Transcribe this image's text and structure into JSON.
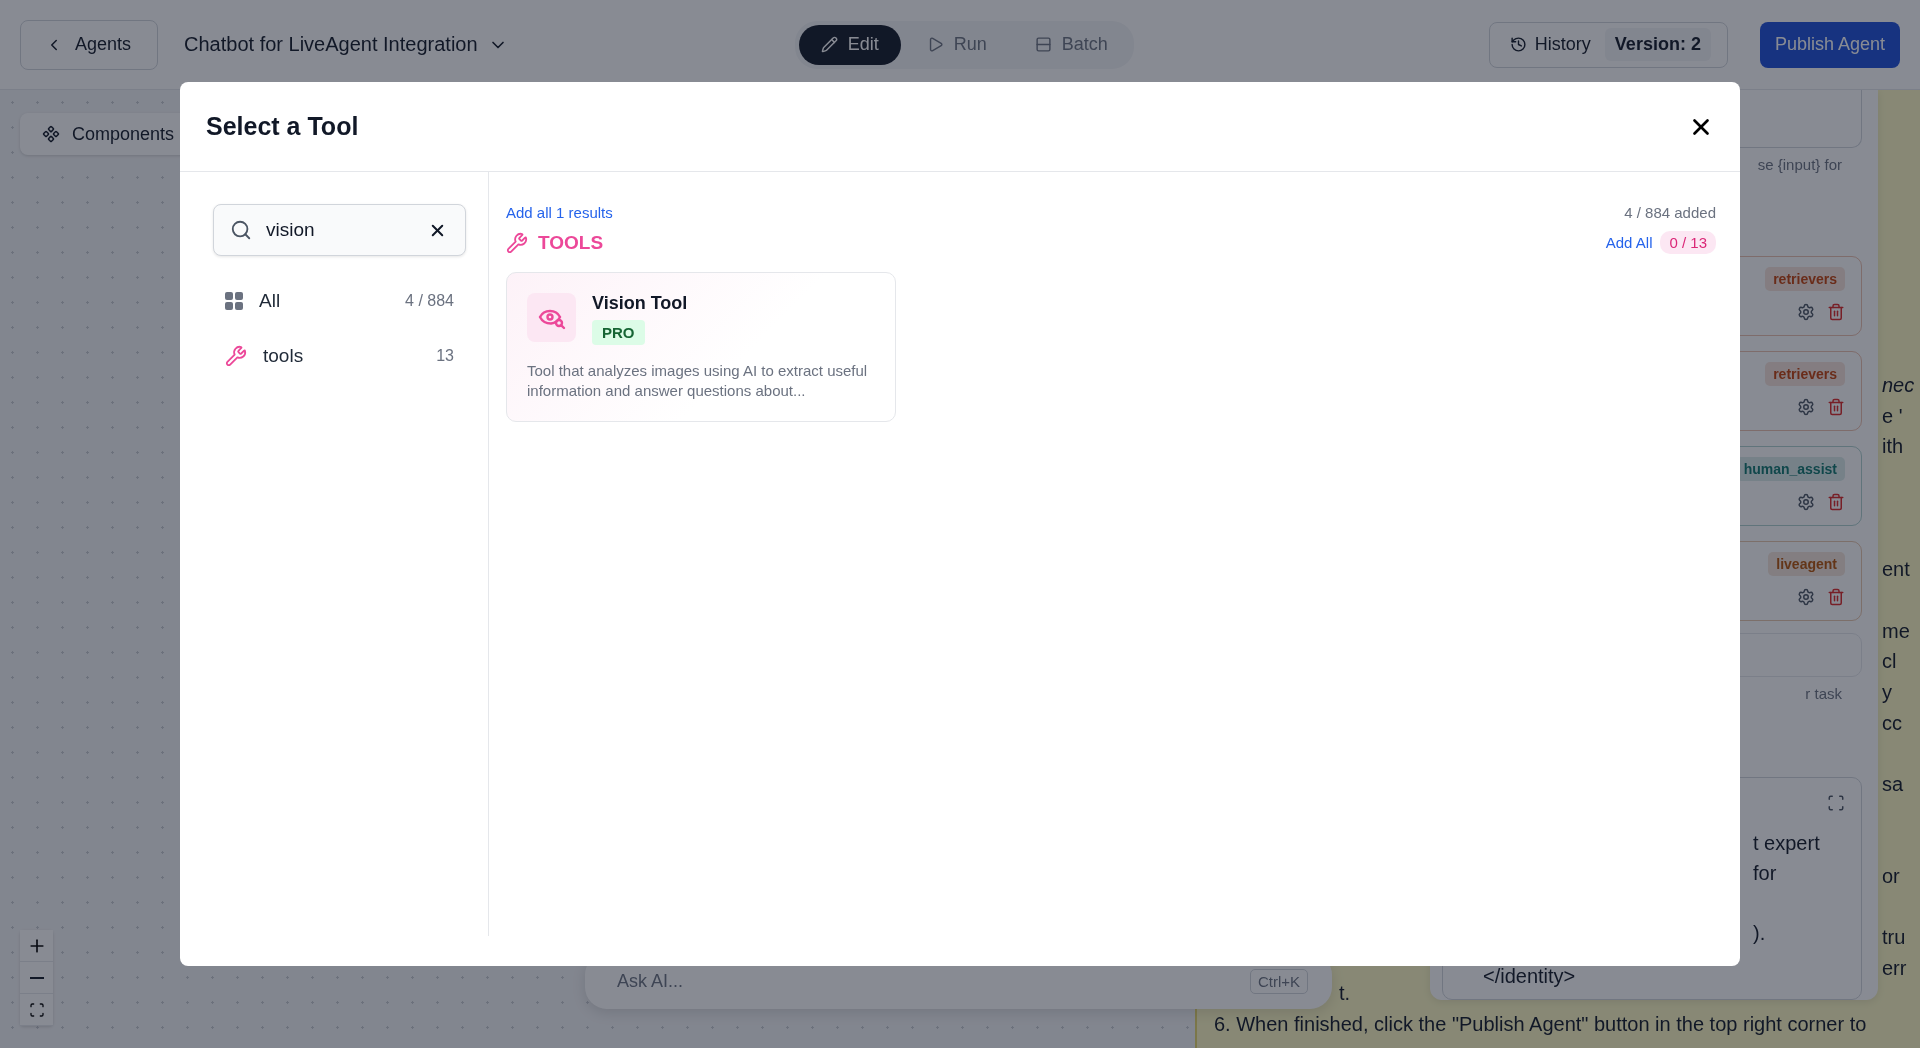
{
  "top_bar": {
    "back_button": "Agents",
    "agent_name": "Chatbot for LiveAgent Integration",
    "modes": [
      {
        "label": "Edit",
        "kind": "edit",
        "selected": true
      },
      {
        "label": "Run",
        "kind": "run",
        "selected": false
      },
      {
        "label": "Batch",
        "kind": "batch",
        "selected": false
      }
    ],
    "history_button": "History",
    "version": "Version: 2",
    "publish_button": "Publish Agent"
  },
  "canvas": {
    "components_button": "Components",
    "ask_ai": {
      "placeholder": "Ask AI...",
      "shortcut": "Ctrl+K"
    },
    "note": {
      "edge_fragments": [
        "nec",
        "e '",
        "ith",
        "ent",
        "me",
        "cl",
        "y",
        "cc",
        "sa",
        "or",
        "tru",
        "err"
      ],
      "lines": [
        "t.",
        "6. When finished, click the \"Publish Agent\" button in the top right corner to"
      ]
    }
  },
  "side_panel": {
    "hint_top": "se {input} for",
    "tool_cards": [
      {
        "tag": "retrievers",
        "kind": "retrieval"
      },
      {
        "tag": "retrievers",
        "kind": "retrieval"
      },
      {
        "tag": "human_assist",
        "kind": "assist"
      },
      {
        "tag": "liveagent",
        "kind": "integration"
      }
    ],
    "hint_bottom": "r task",
    "editor_lines": [
      "t expert",
      "for",
      ")."
    ],
    "editor_tail": "</identity>"
  },
  "dialog": {
    "title": "Select a Tool",
    "search": {
      "value": "vision"
    },
    "categories": [
      {
        "label": "All",
        "count": "4 / 884",
        "kind": "grid"
      },
      {
        "label": "tools",
        "count": "13",
        "kind": "tools"
      }
    ],
    "add_all_results": "Add all 1 results",
    "added_count": "4 / 884 added",
    "sections": [
      {
        "title": "TOOLS",
        "add_all": "Add All",
        "count": "0 / 13",
        "items": [
          {
            "name": "Vision Tool",
            "badge": "PRO",
            "description": "Tool that analyzes images using AI to extract useful information and answer questions about..."
          }
        ]
      }
    ]
  }
}
